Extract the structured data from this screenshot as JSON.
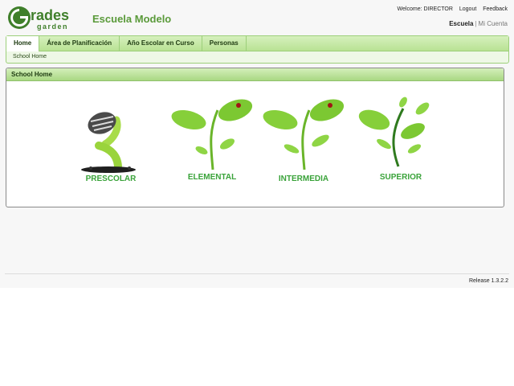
{
  "brand": {
    "logo_top": "rades",
    "logo_bottom": "garden",
    "logo_letter": "G"
  },
  "school": {
    "name": "Escuela Modelo"
  },
  "header": {
    "welcome": "Welcome: DIRECTOR",
    "logout": "Logout",
    "feedback": "Feedback",
    "school_link": "Escuela",
    "account_link": "Mi Cuenta"
  },
  "nav": {
    "tabs": [
      {
        "label": "Home",
        "active": true
      },
      {
        "label": "Área de Planificación",
        "active": false
      },
      {
        "label": "Año Escolar en Curso",
        "active": false
      },
      {
        "label": "Personas",
        "active": false
      }
    ],
    "breadcrumb": "School Home"
  },
  "panel": {
    "title": "School Home",
    "levels": [
      {
        "label": "PRESCOLAR",
        "icon": "seed-sprout-icon"
      },
      {
        "label": "ELEMENTAL",
        "icon": "young-plant-icon"
      },
      {
        "label": "INTERMEDIA",
        "icon": "growing-plant-icon"
      },
      {
        "label": "SUPERIOR",
        "icon": "mature-plant-icon"
      }
    ]
  },
  "footer": {
    "release": "Release 1.3.2.2"
  },
  "colors": {
    "brand_green": "#5a9a3a",
    "leaf_green": "#7cc832",
    "label_green": "#3aa33a",
    "tab_green": "#b9e293"
  }
}
